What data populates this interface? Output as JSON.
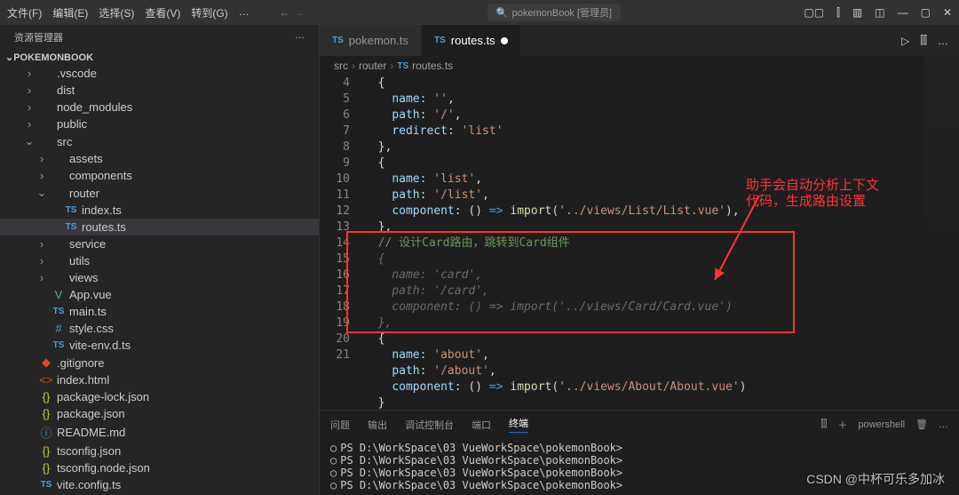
{
  "menu": {
    "file": "文件(F)",
    "edit": "编辑(E)",
    "select": "选择(S)",
    "view": "查看(V)",
    "goto": "转到(G)",
    "more": "…"
  },
  "search": {
    "placeholder": "pokemonBook [管理员]",
    "icon": "🔍"
  },
  "explorer": {
    "title": "资源管理器",
    "more": "…"
  },
  "project": "POKEMONBOOK",
  "tree": [
    {
      "indent": 26,
      "icon": "",
      "type": "folder",
      "name": ".vscode",
      "chev": "›"
    },
    {
      "indent": 26,
      "icon": "",
      "type": "folder",
      "name": "dist",
      "chev": "›"
    },
    {
      "indent": 26,
      "icon": "",
      "type": "folder",
      "name": "node_modules",
      "chev": "›"
    },
    {
      "indent": 26,
      "icon": "",
      "type": "folder",
      "name": "public",
      "chev": "›"
    },
    {
      "indent": 26,
      "icon": "",
      "type": "folder",
      "name": "src",
      "chev": "⌄"
    },
    {
      "indent": 40,
      "icon": "",
      "type": "folder",
      "name": "assets",
      "chev": "›"
    },
    {
      "indent": 40,
      "icon": "",
      "type": "folder",
      "name": "components",
      "chev": "›"
    },
    {
      "indent": 40,
      "icon": "",
      "type": "folder",
      "name": "router",
      "chev": "⌄"
    },
    {
      "indent": 54,
      "icon": "TS",
      "type": "ts",
      "name": "index.ts",
      "chev": ""
    },
    {
      "indent": 54,
      "icon": "TS",
      "type": "ts",
      "name": "routes.ts",
      "chev": "",
      "selected": true
    },
    {
      "indent": 40,
      "icon": "",
      "type": "folder",
      "name": "service",
      "chev": "›"
    },
    {
      "indent": 40,
      "icon": "",
      "type": "folder",
      "name": "utils",
      "chev": "›"
    },
    {
      "indent": 40,
      "icon": "",
      "type": "folder",
      "name": "views",
      "chev": "›"
    },
    {
      "indent": 40,
      "icon": "V",
      "type": "vue",
      "name": "App.vue",
      "chev": ""
    },
    {
      "indent": 40,
      "icon": "TS",
      "type": "ts",
      "name": "main.ts",
      "chev": ""
    },
    {
      "indent": 40,
      "icon": "#",
      "type": "css",
      "name": "style.css",
      "chev": ""
    },
    {
      "indent": 40,
      "icon": "TS",
      "type": "ts",
      "name": "vite-env.d.ts",
      "chev": ""
    },
    {
      "indent": 26,
      "icon": "◆",
      "type": "git",
      "name": ".gitignore",
      "chev": ""
    },
    {
      "indent": 26,
      "icon": "<>",
      "type": "html",
      "name": "index.html",
      "chev": ""
    },
    {
      "indent": 26,
      "icon": "{}",
      "type": "json",
      "name": "package-lock.json",
      "chev": ""
    },
    {
      "indent": 26,
      "icon": "{}",
      "type": "json",
      "name": "package.json",
      "chev": ""
    },
    {
      "indent": 26,
      "icon": "ⓘ",
      "type": "md",
      "name": "README.md",
      "chev": ""
    },
    {
      "indent": 26,
      "icon": "{}",
      "type": "json",
      "name": "tsconfig.json",
      "chev": ""
    },
    {
      "indent": 26,
      "icon": "{}",
      "type": "json",
      "name": "tsconfig.node.json",
      "chev": ""
    },
    {
      "indent": 26,
      "icon": "TS",
      "type": "ts",
      "name": "vite.config.ts",
      "chev": ""
    }
  ],
  "tabs": [
    {
      "icon": "TS",
      "label": "pokemon.ts",
      "active": false
    },
    {
      "icon": "TS",
      "label": "routes.ts",
      "active": true,
      "modified": true
    }
  ],
  "breadcrumb": [
    "src",
    "router",
    "routes.ts"
  ],
  "code_lines": [
    {
      "n": 4,
      "html": "  {"
    },
    {
      "n": 5,
      "html": "    <span class='k-prop'>name</span>: <span class='k-str'>''</span>,"
    },
    {
      "n": 6,
      "html": "    <span class='k-prop'>path</span>: <span class='k-str'>'/'</span>,"
    },
    {
      "n": 7,
      "html": "    <span class='k-prop'>redirect</span>: <span class='k-str'>'list'</span>"
    },
    {
      "n": 8,
      "html": "  },"
    },
    {
      "n": 9,
      "html": "  {"
    },
    {
      "n": 10,
      "html": "    <span class='k-prop'>name</span>: <span class='k-str'>'list'</span>,"
    },
    {
      "n": 11,
      "html": "    <span class='k-prop'>path</span>: <span class='k-str'>'/list'</span>,"
    },
    {
      "n": 12,
      "html": "    <span class='k-prop'>component</span>: () <span class='k-key'>=></span> <span class='k-func'>import</span>(<span class='k-str'>'../views/List/List.vue'</span>),"
    },
    {
      "n": 13,
      "html": "  },"
    },
    {
      "n": 14,
      "html": "  <span class='k-comment'>// 设计Card路由，跳转到Card组件</span>"
    },
    {
      "n": 15,
      "html": "<span class='k-ghost'>  {</span>"
    },
    {
      "n": "",
      "html": "<span class='k-ghost'>    name: 'card',</span>"
    },
    {
      "n": "",
      "html": "<span class='k-ghost'>    path: '/card',</span>"
    },
    {
      "n": "",
      "html": "<span class='k-ghost'>    component: () => import('../views/Card/Card.vue')</span>"
    },
    {
      "n": "",
      "html": "<span class='k-ghost'>  },</span>"
    },
    {
      "n": 16,
      "html": "  {"
    },
    {
      "n": 17,
      "html": "    <span class='k-prop'>name</span>: <span class='k-str'>'about'</span>,"
    },
    {
      "n": 18,
      "html": "    <span class='k-prop'>path</span>: <span class='k-str'>'/about'</span>,"
    },
    {
      "n": 19,
      "html": "    <span class='k-prop'>component</span>: () <span class='k-key'>=></span> <span class='k-func'>import</span>(<span class='k-str'>'../views/About/About.vue'</span>)"
    },
    {
      "n": 20,
      "html": "  }"
    },
    {
      "n": 21,
      "html": "]<span style='background:#564d22'>&nbsp;</span>"
    }
  ],
  "annotation": {
    "text1": "助手会自动分析上下文",
    "text2": "代码，生成路由设置"
  },
  "panel": {
    "tabs": [
      "问题",
      "输出",
      "调试控制台",
      "端口",
      "终端"
    ],
    "active": 4,
    "right": {
      "split": "⫿⫿",
      "new": "＋",
      "shell": "powershell",
      "trash": "🗑",
      "more": "…"
    }
  },
  "terminal_lines": [
    "PS D:\\WorkSpace\\03 VueWorkSpace\\pokemonBook>",
    "PS D:\\WorkSpace\\03 VueWorkSpace\\pokemonBook>",
    "PS D:\\WorkSpace\\03 VueWorkSpace\\pokemonBook>",
    "PS D:\\WorkSpace\\03 VueWorkSpace\\pokemonBook>"
  ],
  "watermark": "CSDN @中杯可乐多加冰"
}
